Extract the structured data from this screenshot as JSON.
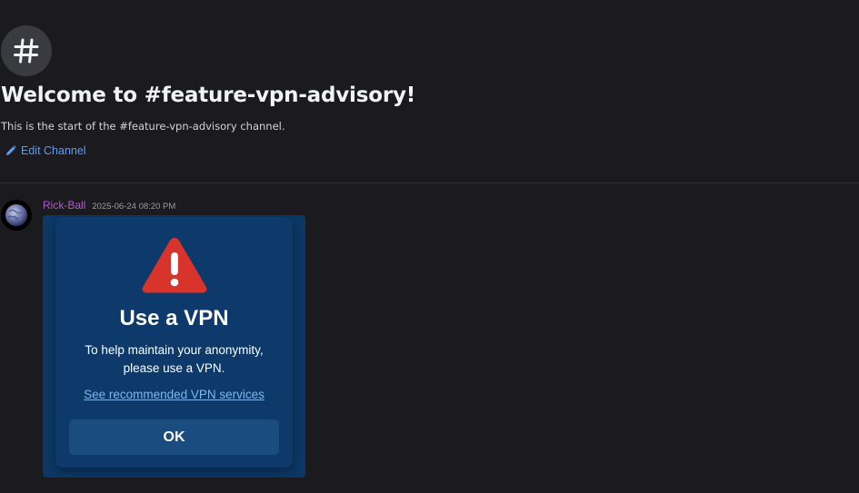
{
  "channel": {
    "hash_symbol": "#",
    "welcome_title": "Welcome to #feature-vpn-advisory!",
    "welcome_subtitle": "This is the start of the #feature-vpn-advisory channel.",
    "edit_label": "Edit Channel"
  },
  "message": {
    "author": "Rick-Ball",
    "timestamp": "2025-06-24 08:20 PM",
    "attachment": {
      "title": "Use a VPN",
      "body_line1": "To help maintain your anonymity,",
      "body_line2": "please use a VPN.",
      "link_text": "See recommended VPN services",
      "ok_label": "OK",
      "warning_icon": "warning-triangle-icon"
    }
  },
  "colors": {
    "background": "#1b1b1f",
    "accent_link": "#5b9cf0",
    "author": "#b05ec9",
    "dialog_bg": "#0d3a6a",
    "warning_red": "#d9342b"
  }
}
